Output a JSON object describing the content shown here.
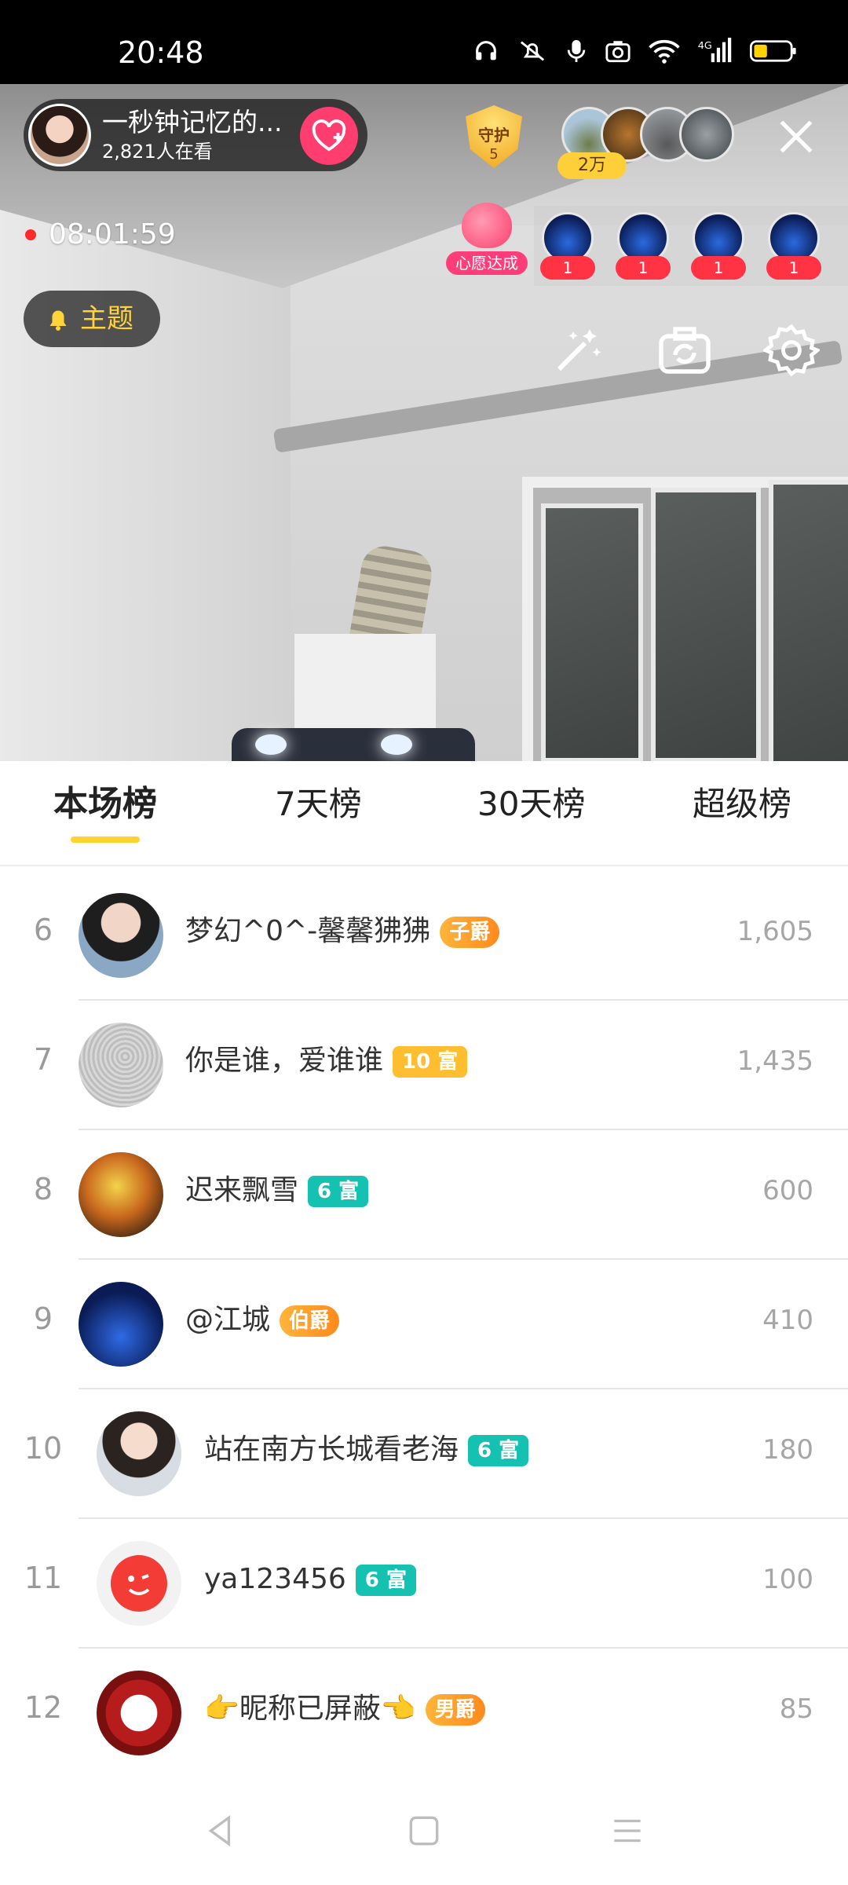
{
  "status_bar": {
    "time": "20:48"
  },
  "live_header": {
    "anchor_name": "一秒钟记忆的...",
    "viewers": "2,821人在看",
    "guard_label": "守护",
    "guard_count": "5",
    "fans_count": "2万"
  },
  "stream": {
    "duration": "08:01:59",
    "wish_label": "心愿达成",
    "rank_badges": [
      "1",
      "1",
      "1",
      "1"
    ],
    "theme_label": "主题"
  },
  "leaderboard": {
    "tabs": [
      "本场榜",
      "7天榜",
      "30天榜",
      "超级榜"
    ],
    "active_tab": "本场榜",
    "rows": [
      {
        "rank": "6",
        "name": "梦幻^0^-馨馨狒狒",
        "badge": "子爵",
        "badge_style": "orange",
        "score": "1,605"
      },
      {
        "rank": "7",
        "name": "你是谁，爱谁谁",
        "badge": "10 富",
        "badge_style": "yellow",
        "score": "1,435"
      },
      {
        "rank": "8",
        "name": "迟来飘雪",
        "badge": "6 富",
        "badge_style": "teal",
        "score": "600"
      },
      {
        "rank": "9",
        "name": "@江城",
        "badge": "伯爵",
        "badge_style": "orange",
        "score": "410"
      },
      {
        "rank": "10",
        "name": "站在南方长城看老海",
        "badge": "6 富",
        "badge_style": "teal",
        "score": "180"
      },
      {
        "rank": "11",
        "name": "ya123456",
        "badge": "6 富",
        "badge_style": "teal",
        "score": "100"
      },
      {
        "rank": "12",
        "name": "👉昵称已屏蔽👈",
        "badge": "男爵",
        "badge_style": "orange",
        "score": "85"
      }
    ]
  },
  "colors": {
    "accent": "#ffd22e",
    "follow": "#ff3d6f",
    "teal_badge": "#15c2b1",
    "yellow_badge": "#ffbe2f"
  },
  "icons": [
    "headphones-icon",
    "silent-icon",
    "mic-icon",
    "camera-icon",
    "wifi-icon",
    "signal-icon",
    "battery-icon",
    "heart-plus-icon",
    "close-icon",
    "bell-icon",
    "magic-wand-icon",
    "camera-flip-icon",
    "gear-icon",
    "back-icon",
    "home-icon",
    "menu-icon"
  ]
}
